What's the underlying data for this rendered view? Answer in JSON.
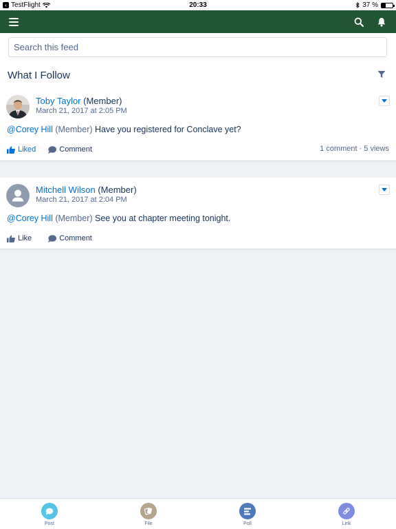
{
  "status_bar": {
    "app": "TestFlight",
    "time": "20:33",
    "battery": "37 %",
    "battery_level": 0.37
  },
  "search": {
    "placeholder": "Search this feed"
  },
  "section": {
    "title": "What I Follow"
  },
  "posts": [
    {
      "author": "Toby Taylor",
      "role": "(Member)",
      "date": "March 21, 2017 at 2:05 PM",
      "mention": "@Corey Hill",
      "mention_role": "(Member)",
      "text": "Have you registered for Conclave yet?",
      "like_label": "Liked",
      "comment_label": "Comment",
      "stats": "1 comment · 5 views"
    },
    {
      "author": "Mitchell Wilson",
      "role": "(Member)",
      "date": "March 21, 2017 at 2:04 PM",
      "mention": "@Corey Hill",
      "mention_role": "(Member)",
      "text": "See you at chapter meeting tonight.",
      "like_label": "Like",
      "comment_label": "Comment"
    }
  ],
  "toolbar": {
    "items": [
      {
        "label": "Post",
        "icon": "post-icon",
        "color": "#54c5e6"
      },
      {
        "label": "File",
        "icon": "file-icon",
        "color": "#b4a48c"
      },
      {
        "label": "Poll",
        "icon": "poll-icon",
        "color": "#4d7ab8"
      },
      {
        "label": "Link",
        "icon": "link-icon",
        "color": "#7f8de1"
      }
    ]
  },
  "colors": {
    "nav": "#215534",
    "link": "#0070d2",
    "text": "#16325c"
  }
}
